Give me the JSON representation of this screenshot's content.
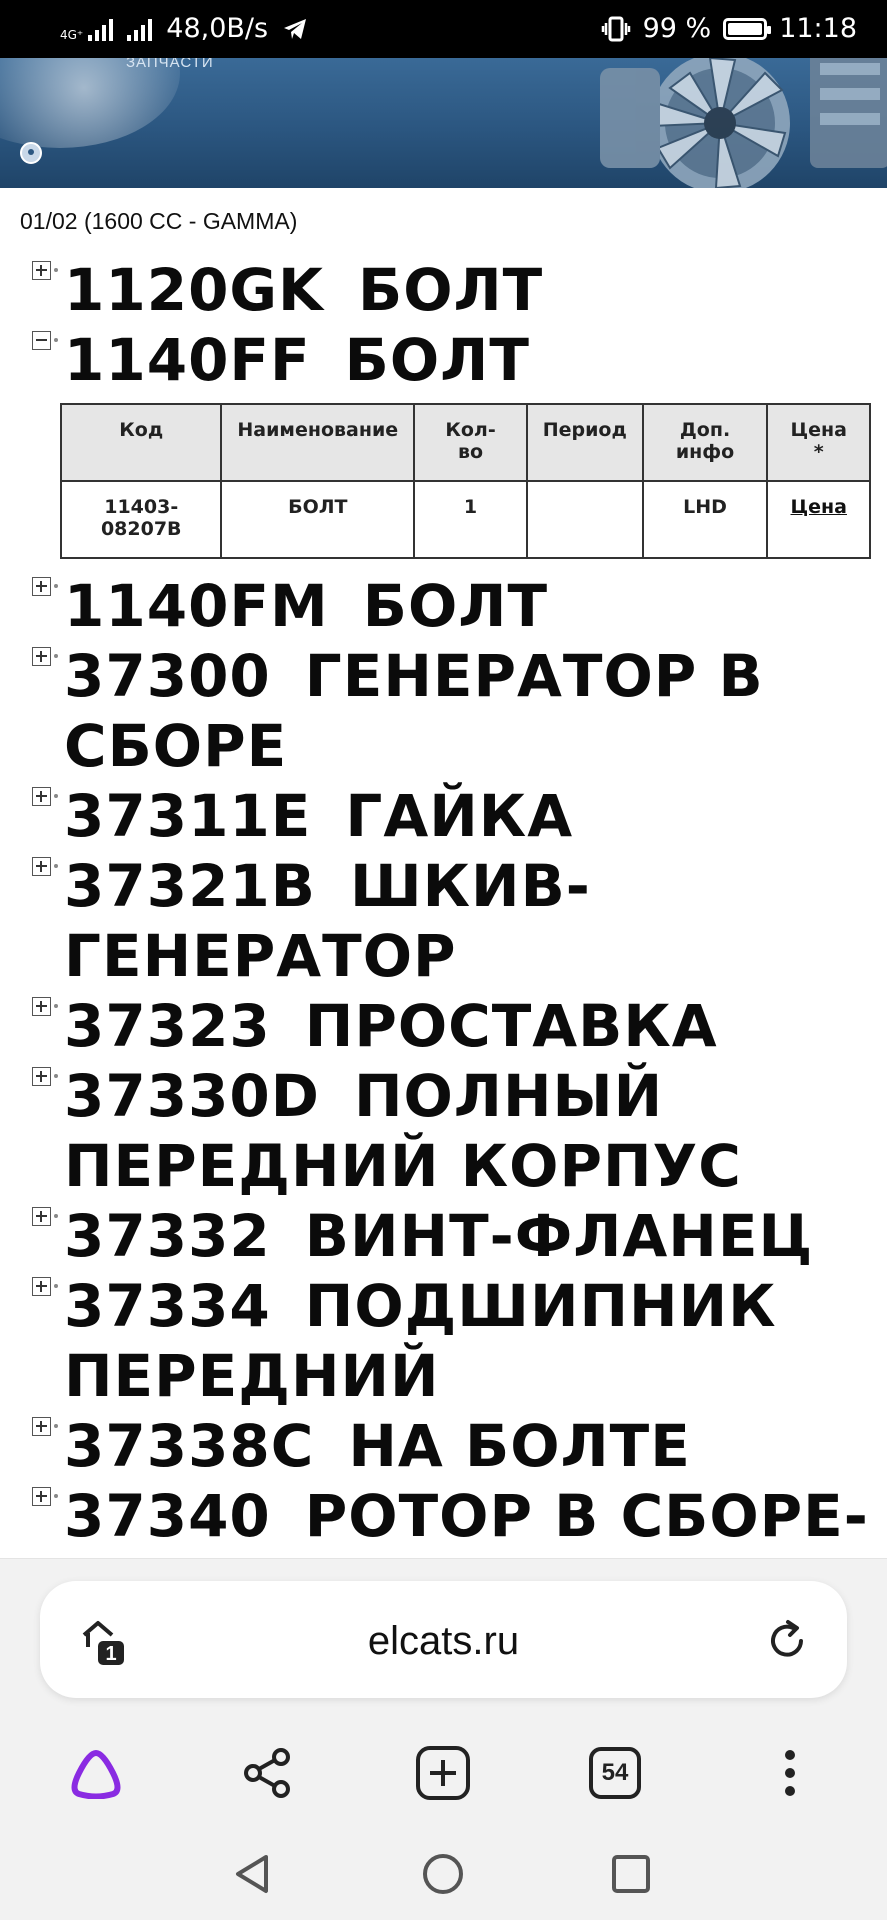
{
  "status_bar": {
    "network_label": "4G⁺",
    "speed": "48,0B/s",
    "battery_percent": "99 %",
    "battery_level": 0.99,
    "time": "11:18"
  },
  "breadcrumb": "01/02 (1600 CC - GAMMA)",
  "parts": [
    {
      "code": "1120GK",
      "name": "БОЛТ",
      "expanded": false
    },
    {
      "code": "1140FF",
      "name": "БОЛТ",
      "expanded": true
    },
    {
      "code": "1140FM",
      "name": "БОЛТ",
      "expanded": false
    },
    {
      "code": "37300",
      "name": "ГЕНЕРАТОР В СБОРЕ",
      "expanded": false
    },
    {
      "code": "37311E",
      "name": "ГАЙКА",
      "expanded": false
    },
    {
      "code": "37321B",
      "name": "ШКИВ-ГЕНЕРАТОР",
      "expanded": false
    },
    {
      "code": "37323",
      "name": "ПРОСТАВКА",
      "expanded": false
    },
    {
      "code": "37330D",
      "name": "ПОЛНЫЙ ПЕРЕДНИЙ КОРПУС",
      "expanded": false
    },
    {
      "code": "37332",
      "name": "ВИНТ-ФЛАНЕЦ",
      "expanded": false
    },
    {
      "code": "37334",
      "name": "ПОДШИПНИК ПЕРЕДНИЙ",
      "expanded": false
    },
    {
      "code": "37338C",
      "name": "НА БОЛТЕ",
      "expanded": false
    },
    {
      "code": "37340",
      "name": "РОТОР В СБОРЕ-ГЕНЕРАТОР",
      "expanded": false
    }
  ],
  "detail_table": {
    "headers": [
      "Код",
      "Наименование",
      "Кол-во",
      "Период",
      "Доп. инфо",
      "Цена *"
    ],
    "row": {
      "code": "11403-08207B",
      "name": "БОЛТ",
      "qty": "1",
      "period": "",
      "info": "LHD",
      "price_link": "Цена"
    }
  },
  "browser": {
    "url": "elcats.ru",
    "shield_badge": "1",
    "tabs_count": "54"
  }
}
